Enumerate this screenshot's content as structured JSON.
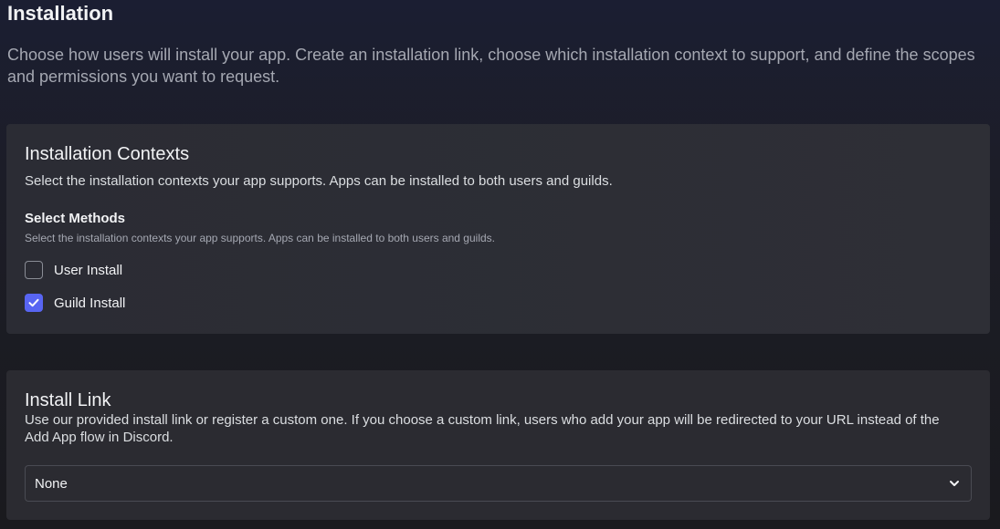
{
  "page": {
    "title": "Installation",
    "description": "Choose how users will install your app. Create an installation link, choose which installation context to support, and define the scopes and permissions you want to request."
  },
  "contexts": {
    "title": "Installation Contexts",
    "description": "Select the installation contexts your app supports. Apps can be installed to both users and guilds.",
    "methods_label": "Select Methods",
    "methods_hint": "Select the installation contexts your app supports. Apps can be installed to both users and guilds.",
    "options": [
      {
        "label": "User Install",
        "checked": false
      },
      {
        "label": "Guild Install",
        "checked": true
      }
    ]
  },
  "install_link": {
    "title": "Install Link",
    "description": "Use our provided install link or register a custom one. If you choose a custom link, users who add your app will be redirected to your URL instead of the Add App flow in Discord.",
    "selected": "None"
  },
  "colors": {
    "accent": "#5865f2",
    "card_bg": "#2b2c33"
  },
  "icons": {
    "checkmark": "checkmark-icon",
    "dropdown": "chevron-down-icon"
  }
}
